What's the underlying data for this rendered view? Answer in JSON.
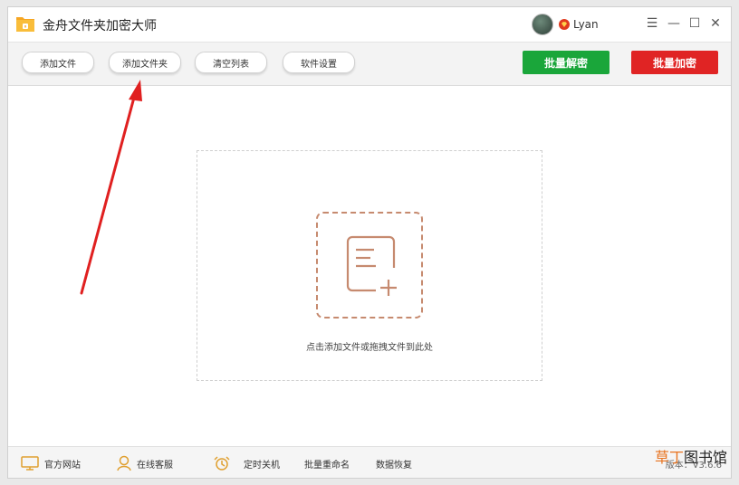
{
  "app": {
    "title": "金舟文件夹加密大师"
  },
  "user": {
    "name": "Lyan"
  },
  "window_controls": {
    "menu": "☰",
    "minimize": "—",
    "maximize": "☐",
    "close": "✕"
  },
  "toolbar": {
    "add_file": "添加文件",
    "add_folder": "添加文件夹",
    "clear_list": "清空列表",
    "settings": "软件设置",
    "batch_decrypt": "批量解密",
    "batch_encrypt": "批量加密"
  },
  "dropzone": {
    "hint": "点击添加文件或拖拽文件到此处"
  },
  "statusbar": {
    "website": "官方网站",
    "support": "在线客服",
    "shutdown": "定时关机",
    "rename": "批量重命名",
    "recovery": "数据恢复",
    "version": "版本：V3.6.6"
  },
  "watermark": {
    "text1": "草丁",
    "text2": "图书馆"
  },
  "colors": {
    "accent_green": "#1aa63a",
    "accent_red": "#e02424",
    "icon_orange": "#c68a6f",
    "arrow_red": "#e02020"
  },
  "icons": [
    "folder-lock-icon",
    "vip-diamond-icon",
    "document-add-icon",
    "monitor-icon",
    "headset-user-icon",
    "alarm-icon"
  ]
}
